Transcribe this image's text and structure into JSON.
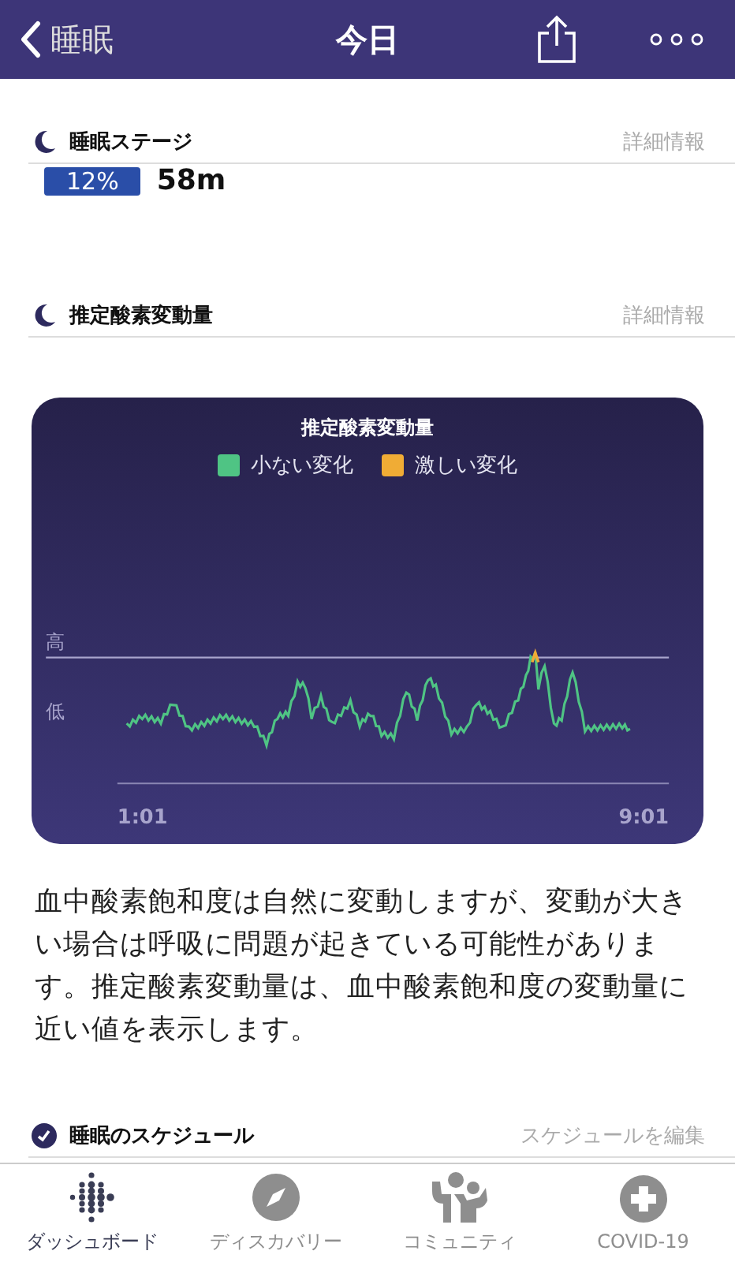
{
  "nav": {
    "back": "睡眠",
    "title": "今日"
  },
  "sleep_stage": {
    "title": "睡眠ステージ",
    "link": "詳細情報",
    "percent": "12%",
    "duration": "58m"
  },
  "oxygen": {
    "title": "推定酸素変動量",
    "link": "詳細情報"
  },
  "chart": {
    "title": "推定酸素変動量",
    "legend": [
      {
        "label": "小ない変化",
        "color": "#4fc484"
      },
      {
        "label": "激しい変化",
        "color": "#f0ac35"
      }
    ],
    "y_high": "高",
    "y_low": "低",
    "x_start": "1:01",
    "x_end": "9:01"
  },
  "description": "血中酸素飽和度は自然に変動しますが、変動が大きい場合は呼吸に問題が起きている可能性があります。推定酸素変動量は、血中酸素飽和度の変動量に近い値を表示します。",
  "schedule": {
    "title": "睡眠のスケジュール",
    "link": "スケジュールを編集"
  },
  "tabs": [
    {
      "label": "ダッシュボード",
      "selected": true
    },
    {
      "label": "ディスカバリー",
      "selected": false
    },
    {
      "label": "コミュニティ",
      "selected": false
    },
    {
      "label": "COVID-19",
      "selected": false
    }
  ]
}
